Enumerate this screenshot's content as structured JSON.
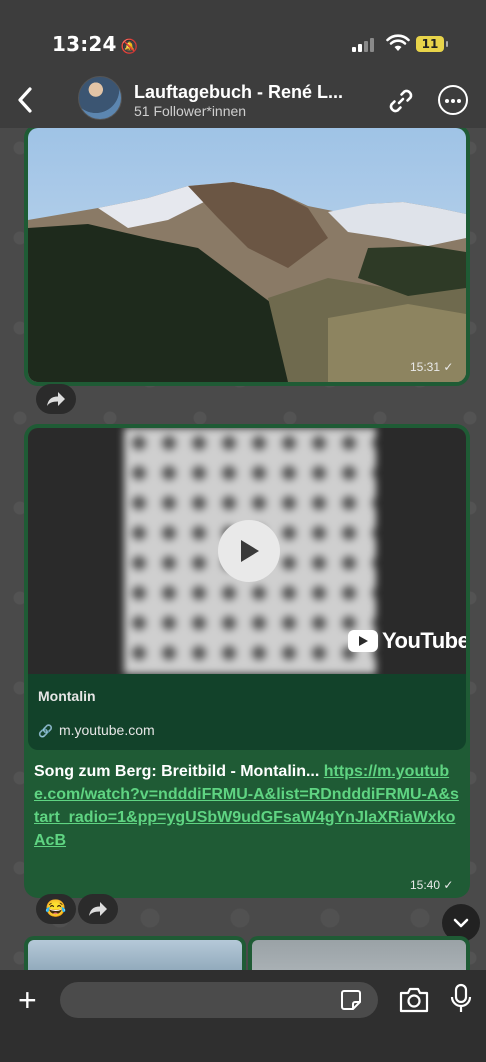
{
  "status": {
    "time": "13:24",
    "battery": "11"
  },
  "header": {
    "title": "Lauftagebuch - René L...",
    "subtitle": "51 Follower*innen"
  },
  "messages": {
    "image_time": "15:31",
    "link_preview": {
      "title": "Montalin",
      "domain": "m.youtube.com",
      "brand": "YouTube"
    },
    "text": "Song zum Berg: Breitbild - Montalin...",
    "url": "https://m.youtube.com/watch?v=ndddiFRMU-A&list=RDndddiFRMU-A&start_radio=1&pp=ygUSbW9udGFsaW4gYnJlaXRiaWxkoAcB",
    "link_time": "15:40",
    "reaction": "😂"
  },
  "composer": {
    "placeholder": ""
  },
  "colors": {
    "bubble": "#1f5b35",
    "link": "#5fd482",
    "header": "#3d3d3d"
  }
}
